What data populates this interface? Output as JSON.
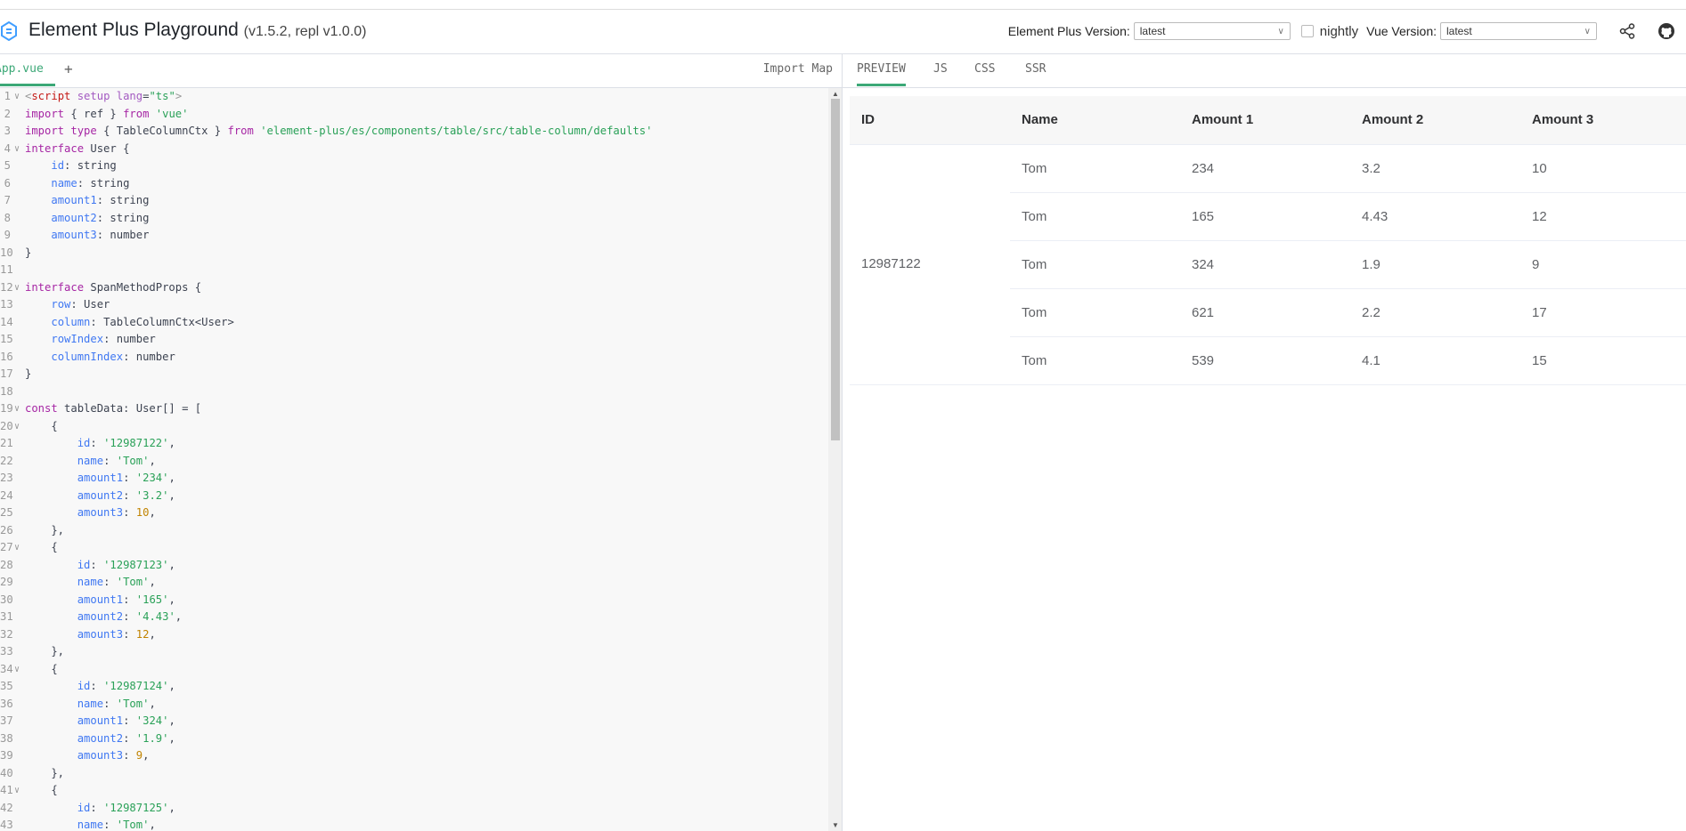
{
  "header": {
    "title": "Element Plus Playground",
    "version_text": "(v1.5.2, repl v1.0.0)",
    "element_plus_version_label": "Element Plus Version:",
    "element_plus_version_value": "latest",
    "nightly_label": "nightly",
    "vue_version_label": "Vue Version:",
    "vue_version_value": "latest"
  },
  "editor": {
    "tab_label": "App.vue",
    "add_tab_label": "+",
    "import_map_label": "Import Map",
    "lines": [
      {
        "n": "1",
        "fold": true,
        "html": "<span style='color:#999'>&lt;</span><span style='color:#c41a16'>script</span> <span style='color:#a35ac1'>setup</span> <span style='color:#a35ac1'>lang</span>=<span style='color:#2aa158'>\"ts\"</span><span style='color:#999'>&gt;</span>"
      },
      {
        "n": "2",
        "fold": false,
        "html": "<span style='color:#a626a4'>import</span> { ref } <span style='color:#a626a4'>from</span> <span style='color:#2aa158'>'vue'</span>"
      },
      {
        "n": "3",
        "fold": false,
        "html": "<span style='color:#a626a4'>import</span> <span style='color:#a626a4'>type</span> { TableColumnCtx } <span style='color:#a626a4'>from</span> <span style='color:#2aa158'>'element-plus/es/components/table/src/table-column/defaults'</span>"
      },
      {
        "n": "4",
        "fold": true,
        "html": "<span style='color:#a626a4'>interface</span> User {"
      },
      {
        "n": "5",
        "fold": false,
        "html": "    <span style='color:#4078f2'>id</span>: string"
      },
      {
        "n": "6",
        "fold": false,
        "html": "    <span style='color:#4078f2'>name</span>: string"
      },
      {
        "n": "7",
        "fold": false,
        "html": "    <span style='color:#4078f2'>amount1</span>: string"
      },
      {
        "n": "8",
        "fold": false,
        "html": "    <span style='color:#4078f2'>amount2</span>: string"
      },
      {
        "n": "9",
        "fold": false,
        "html": "    <span style='color:#4078f2'>amount3</span>: number"
      },
      {
        "n": "10",
        "fold": false,
        "html": "}"
      },
      {
        "n": "11",
        "fold": false,
        "html": ""
      },
      {
        "n": "12",
        "fold": true,
        "html": "<span style='color:#a626a4'>interface</span> SpanMethodProps {"
      },
      {
        "n": "13",
        "fold": false,
        "html": "    <span style='color:#4078f2'>row</span>: User"
      },
      {
        "n": "14",
        "fold": false,
        "html": "    <span style='color:#4078f2'>column</span>: TableColumnCtx&lt;User&gt;"
      },
      {
        "n": "15",
        "fold": false,
        "html": "    <span style='color:#4078f2'>rowIndex</span>: number"
      },
      {
        "n": "16",
        "fold": false,
        "html": "    <span style='color:#4078f2'>columnIndex</span>: number"
      },
      {
        "n": "17",
        "fold": false,
        "html": "}"
      },
      {
        "n": "18",
        "fold": false,
        "html": ""
      },
      {
        "n": "19",
        "fold": true,
        "html": "<span style='color:#a626a4'>const</span> tableData: User[] = ["
      },
      {
        "n": "20",
        "fold": true,
        "html": "    {"
      },
      {
        "n": "21",
        "fold": false,
        "html": "        <span style='color:#4078f2'>id</span>: <span style='color:#2aa158'>'12987122'</span>,"
      },
      {
        "n": "22",
        "fold": false,
        "html": "        <span style='color:#4078f2'>name</span>: <span style='color:#2aa158'>'Tom'</span>,"
      },
      {
        "n": "23",
        "fold": false,
        "html": "        <span style='color:#4078f2'>amount1</span>: <span style='color:#2aa158'>'234'</span>,"
      },
      {
        "n": "24",
        "fold": false,
        "html": "        <span style='color:#4078f2'>amount2</span>: <span style='color:#2aa158'>'3.2'</span>,"
      },
      {
        "n": "25",
        "fold": false,
        "html": "        <span style='color:#4078f2'>amount3</span>: <span style='color:#c18401'>10</span>,"
      },
      {
        "n": "26",
        "fold": false,
        "html": "    },"
      },
      {
        "n": "27",
        "fold": true,
        "html": "    {"
      },
      {
        "n": "28",
        "fold": false,
        "html": "        <span style='color:#4078f2'>id</span>: <span style='color:#2aa158'>'12987123'</span>,"
      },
      {
        "n": "29",
        "fold": false,
        "html": "        <span style='color:#4078f2'>name</span>: <span style='color:#2aa158'>'Tom'</span>,"
      },
      {
        "n": "30",
        "fold": false,
        "html": "        <span style='color:#4078f2'>amount1</span>: <span style='color:#2aa158'>'165'</span>,"
      },
      {
        "n": "31",
        "fold": false,
        "html": "        <span style='color:#4078f2'>amount2</span>: <span style='color:#2aa158'>'4.43'</span>,"
      },
      {
        "n": "32",
        "fold": false,
        "html": "        <span style='color:#4078f2'>amount3</span>: <span style='color:#c18401'>12</span>,"
      },
      {
        "n": "33",
        "fold": false,
        "html": "    },"
      },
      {
        "n": "34",
        "fold": true,
        "html": "    {"
      },
      {
        "n": "35",
        "fold": false,
        "html": "        <span style='color:#4078f2'>id</span>: <span style='color:#2aa158'>'12987124'</span>,"
      },
      {
        "n": "36",
        "fold": false,
        "html": "        <span style='color:#4078f2'>name</span>: <span style='color:#2aa158'>'Tom'</span>,"
      },
      {
        "n": "37",
        "fold": false,
        "html": "        <span style='color:#4078f2'>amount1</span>: <span style='color:#2aa158'>'324'</span>,"
      },
      {
        "n": "38",
        "fold": false,
        "html": "        <span style='color:#4078f2'>amount2</span>: <span style='color:#2aa158'>'1.9'</span>,"
      },
      {
        "n": "39",
        "fold": false,
        "html": "        <span style='color:#4078f2'>amount3</span>: <span style='color:#c18401'>9</span>,"
      },
      {
        "n": "40",
        "fold": false,
        "html": "    },"
      },
      {
        "n": "41",
        "fold": true,
        "html": "    {"
      },
      {
        "n": "42",
        "fold": false,
        "html": "        <span style='color:#4078f2'>id</span>: <span style='color:#2aa158'>'12987125'</span>,"
      },
      {
        "n": "43",
        "fold": false,
        "html": "        <span style='color:#4078f2'>name</span>: <span style='color:#2aa158'>'Tom'</span>,"
      }
    ]
  },
  "preview": {
    "tabs": [
      "PREVIEW",
      "JS",
      "CSS",
      "SSR"
    ],
    "active_tab": "PREVIEW",
    "table": {
      "columns": [
        "ID",
        "Name",
        "Amount 1",
        "Amount 2",
        "Amount 3"
      ],
      "merged_id": "12987122",
      "rows": [
        {
          "name": "Tom",
          "amount1": "234",
          "amount2": "3.2",
          "amount3": "10"
        },
        {
          "name": "Tom",
          "amount1": "165",
          "amount2": "4.43",
          "amount3": "12"
        },
        {
          "name": "Tom",
          "amount1": "324",
          "amount2": "1.9",
          "amount3": "9"
        },
        {
          "name": "Tom",
          "amount1": "621",
          "amount2": "2.2",
          "amount3": "17"
        },
        {
          "name": "Tom",
          "amount1": "539",
          "amount2": "4.1",
          "amount3": "15"
        }
      ]
    }
  },
  "colors": {
    "accent": "#3ca877",
    "border": "#dcdfe6",
    "code_bg": "#f8f8f8"
  },
  "icons": {
    "logo": "element-plus-logo",
    "share": "share-icon",
    "github": "github-icon"
  }
}
